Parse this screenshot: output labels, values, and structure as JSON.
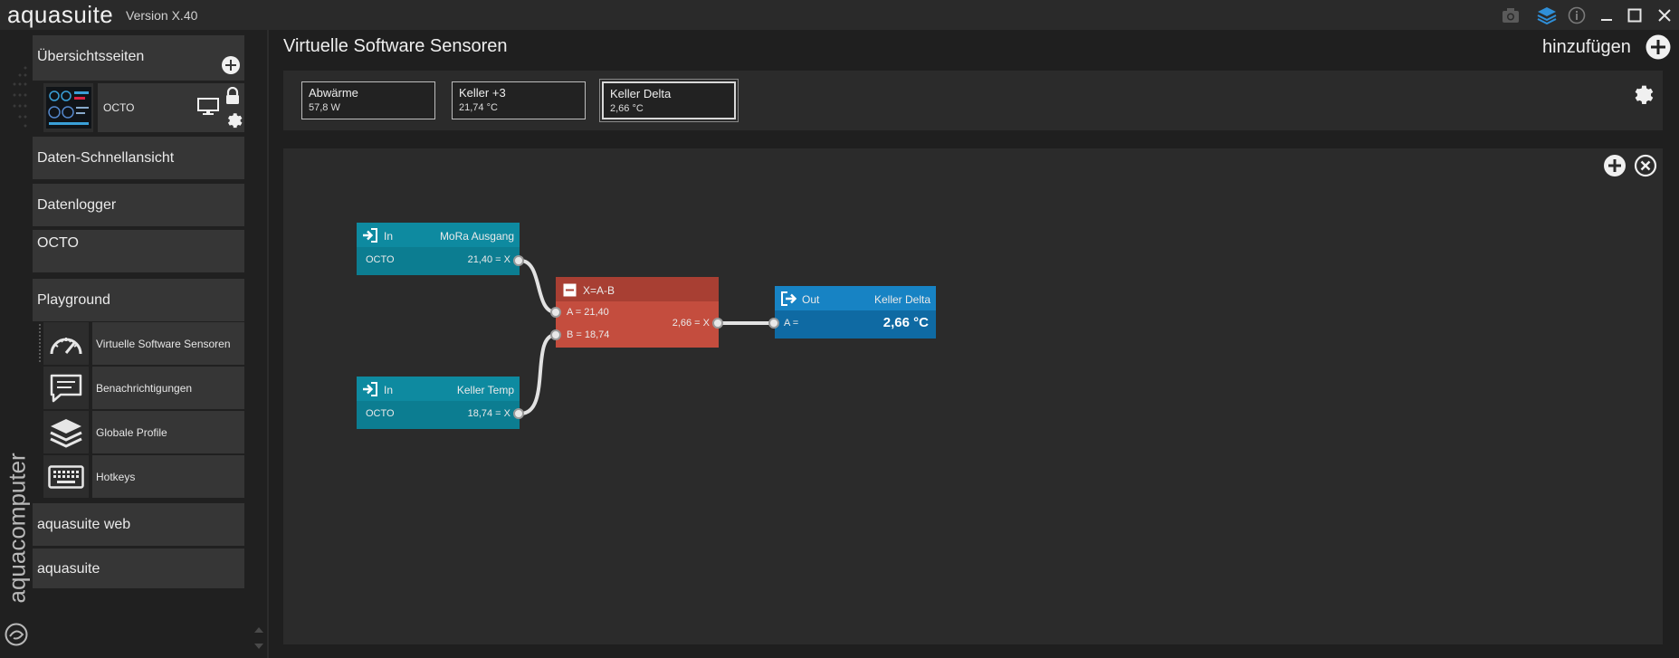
{
  "app": {
    "brand": "aquasuite",
    "version": "Version X.40",
    "vertical_logo": "aquacomputer"
  },
  "titlebar": {
    "icons": [
      "camera-icon",
      "layers-icon",
      "info-icon",
      "minimize-icon",
      "maximize-icon",
      "close-icon"
    ]
  },
  "sidebar": {
    "overview": {
      "label": "Übersichtsseiten",
      "page_name": "OCTO"
    },
    "items": [
      {
        "label": "Daten-Schnellansicht"
      },
      {
        "label": "Datenlogger"
      },
      {
        "label": "OCTO"
      },
      {
        "label": "Playground"
      }
    ],
    "playground_children": [
      {
        "label": "Virtuelle Software Sensoren",
        "icon": "gauge-icon"
      },
      {
        "label": "Benachrichtigungen",
        "icon": "chat-icon"
      },
      {
        "label": "Globale Profile",
        "icon": "layers-icon"
      },
      {
        "label": "Hotkeys",
        "icon": "keyboard-icon"
      }
    ],
    "bottom_items": [
      {
        "label": "aquasuite web"
      },
      {
        "label": "aquasuite"
      }
    ]
  },
  "main": {
    "title": "Virtuelle Software Sensoren",
    "add_label": "hinzufügen"
  },
  "sensors": [
    {
      "title": "Abwärme",
      "value": "57,8 W"
    },
    {
      "title": "Keller +3",
      "value": "21,74 °C"
    },
    {
      "title": "Keller Delta",
      "value": "2,66 °C"
    }
  ],
  "nodes": {
    "in1": {
      "type": "In",
      "name": "MoRa Ausgang",
      "source": "OCTO",
      "value": "21,40 = X"
    },
    "in2": {
      "type": "In",
      "name": "Keller Temp",
      "source": "OCTO",
      "value": "18,74 = X"
    },
    "op": {
      "formula": "X=A-B",
      "a": "A = 21,40",
      "b": "B = 18,74",
      "result": "2,66 = X"
    },
    "out": {
      "type": "Out",
      "name": "Keller Delta",
      "input": "A =",
      "value": "2,66 °C"
    }
  },
  "colors": {
    "accent": "#1497ad",
    "out": "#1477b5",
    "operation": "#c24a3c"
  }
}
